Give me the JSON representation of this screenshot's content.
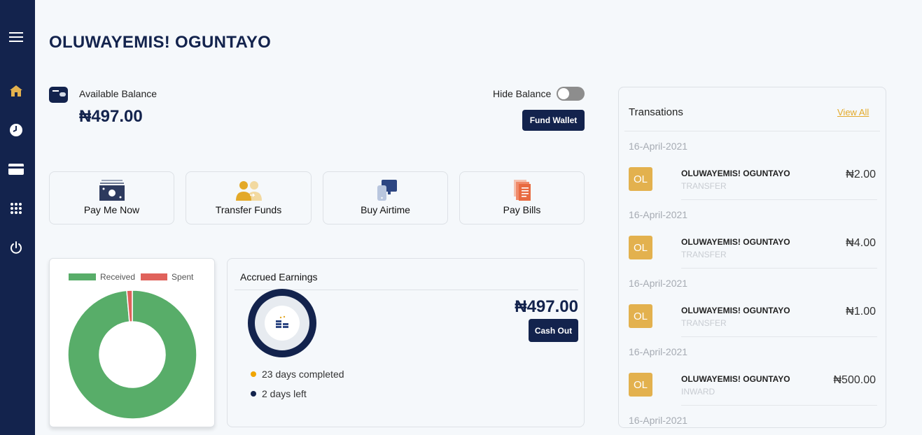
{
  "user": {
    "name": "OLUWAYEMIS! OGUNTAYO"
  },
  "sidebar": {
    "items": [
      {
        "icon": "menu-icon"
      },
      {
        "icon": "home-icon",
        "active": true
      },
      {
        "icon": "clock-icon"
      },
      {
        "icon": "card-icon"
      },
      {
        "icon": "apps-grid-icon"
      },
      {
        "icon": "power-icon"
      }
    ]
  },
  "balance": {
    "label": "Available Balance",
    "amount": "₦497.00",
    "hide_label": "Hide Balance",
    "hide_enabled": false,
    "fund_button": "Fund Wallet"
  },
  "actions": [
    {
      "label": "Pay Me Now",
      "icon": "cash-icon"
    },
    {
      "label": "Transfer Funds",
      "icon": "transfer-users-icon"
    },
    {
      "label": "Buy Airtime",
      "icon": "phone-airtime-icon"
    },
    {
      "label": "Pay Bills",
      "icon": "bills-document-icon"
    }
  ],
  "chart_data": {
    "type": "pie",
    "donut": true,
    "legend_position": "top",
    "labels": [
      "Received",
      "Spent"
    ],
    "values": [
      498,
      7
    ],
    "colors": [
      "#58ad69",
      "#e0625b"
    ]
  },
  "earnings": {
    "title": "Accrued Earnings",
    "amount": "₦497.00",
    "cash_out_button": "Cash Out",
    "days_completed": "23 days completed",
    "days_left": "2 days left",
    "completed_color": "#f0a500",
    "left_color": "#13234d"
  },
  "transactions": {
    "title": "Transations",
    "view_all": "View All",
    "items": [
      {
        "date": "16-April-2021",
        "initials": "OL",
        "name": "OLUWAYEMIS! OGUNTAYO",
        "type": "TRANSFER",
        "amount": "₦2.00"
      },
      {
        "date": "16-April-2021",
        "initials": "OL",
        "name": "OLUWAYEMIS! OGUNTAYO",
        "type": "TRANSFER",
        "amount": "₦4.00"
      },
      {
        "date": "16-April-2021",
        "initials": "OL",
        "name": "OLUWAYEMIS! OGUNTAYO",
        "type": "TRANSFER",
        "amount": "₦1.00"
      },
      {
        "date": "16-April-2021",
        "initials": "OL",
        "name": "OLUWAYEMIS! OGUNTAYO",
        "type": "INWARD",
        "amount": "₦500.00"
      },
      {
        "date": "16-April-2021"
      }
    ]
  },
  "colors": {
    "navy": "#13234d",
    "gold": "#e3b14e",
    "accent_link": "#e3a929"
  }
}
